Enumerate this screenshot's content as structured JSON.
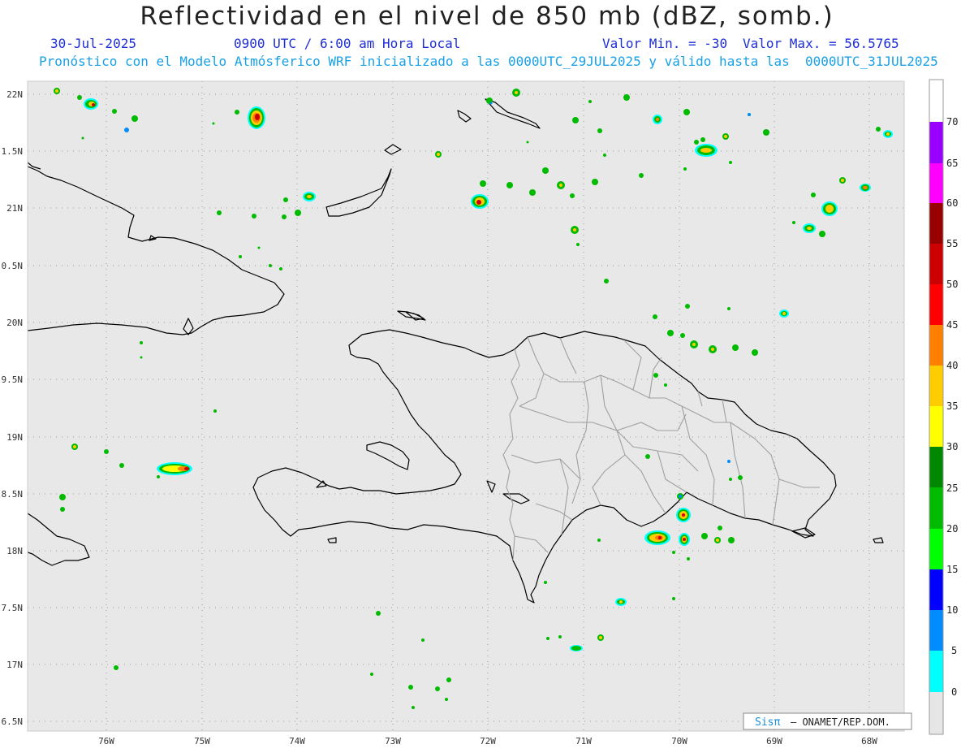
{
  "header": {
    "title": "Reflectividad en el nivel de 850 mb (dBZ, somb.)",
    "date": "30-Jul-2025",
    "time": "0900 UTC / 6:00 am Hora Local",
    "valmin": "Valor Min. = -30",
    "valmax": "Valor Max. = 56.5765",
    "forecast": "Pronóstico con el Modelo Atmósferico WRF inicializado a las 0000UTC_29JUL2025 y válido hasta las  0000UTC_31JUL2025"
  },
  "map": {
    "lat_labels": [
      "22N",
      "1.5N",
      "21N",
      "0.5N",
      "20N",
      "9.5N",
      "19N",
      "8.5N",
      "18N",
      "7.5N",
      "17N",
      "6.5N"
    ],
    "lon_labels": [
      "76W",
      "75W",
      "74W",
      "73W",
      "72W",
      "71W",
      "70W",
      "69W",
      "68W"
    ],
    "background": "#e8e8e8",
    "coastline_color": "#000000",
    "province_color": "#a0a0a0"
  },
  "colorbar": {
    "labels": [
      "70",
      "65",
      "60",
      "55",
      "50",
      "45",
      "40",
      "35",
      "30",
      "25",
      "20",
      "15",
      "10",
      "5",
      "0"
    ],
    "colors": [
      "#ffffff",
      "#9900ff",
      "#ff00ff",
      "#990000",
      "#cc0000",
      "#ff0000",
      "#ff7f00",
      "#ffcc00",
      "#ffff00",
      "#008800",
      "#00bb00",
      "#00ff00",
      "#0000ff",
      "#008cff",
      "#00ffff",
      "#e6e6e6"
    ]
  },
  "credit": {
    "logo": "Sisπ",
    "text": "– ONAMET/REP.DOM."
  }
}
